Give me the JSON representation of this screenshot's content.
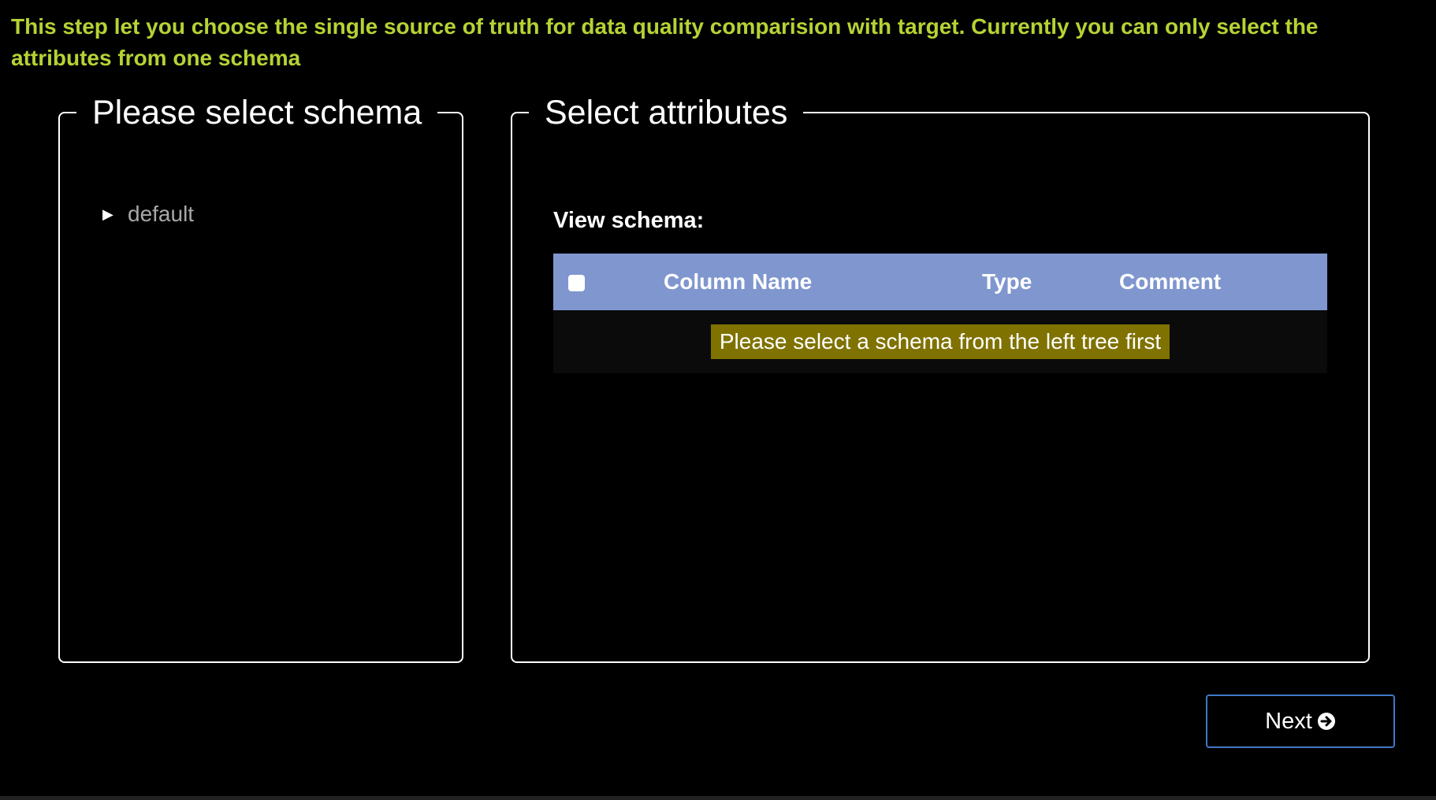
{
  "intro": {
    "text": "This step let you choose the single source of truth for data quality comparision with target. Currently you can only select the attributes from one schema"
  },
  "schema_panel": {
    "legend": "Please select schema",
    "tree": [
      {
        "label": "default",
        "expanded": false
      }
    ]
  },
  "attributes_panel": {
    "legend": "Select attributes",
    "view_label": "View schema:",
    "table": {
      "columns": [
        "Column Name",
        "Type",
        "Comment"
      ],
      "empty_message": "Please select a schema from the left tree first"
    }
  },
  "footer": {
    "next_label": "Next"
  },
  "colors": {
    "background": "#000000",
    "intro_text": "#b5d334",
    "table_header": "#7f96cf",
    "empty_highlight": "#7f7200",
    "button_border": "#3f78c8"
  },
  "icons": {
    "tree_toggle": "caret-right-icon",
    "next": "arrow-circle-right-icon"
  }
}
